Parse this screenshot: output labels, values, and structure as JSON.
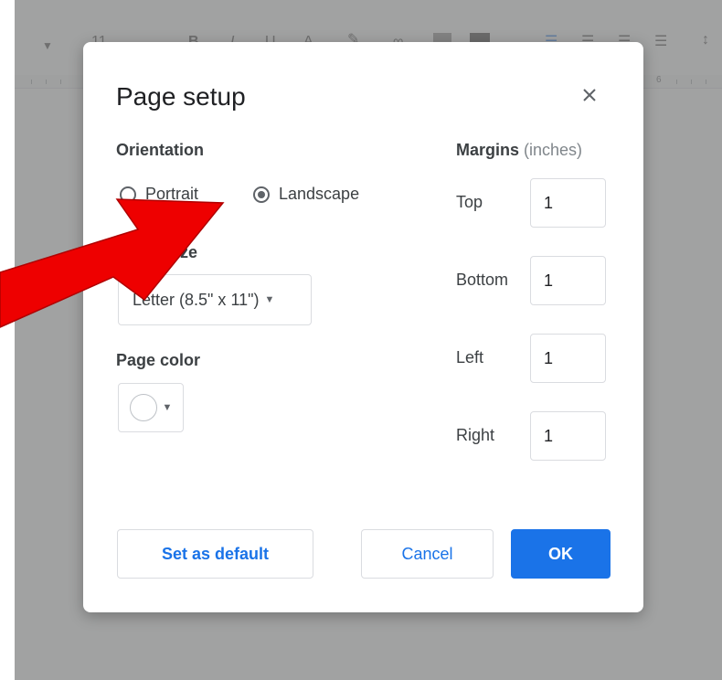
{
  "background": {
    "toolbar": {
      "font_size": "11",
      "bold": "B",
      "italic": "I",
      "underline": "U",
      "text_color": "A"
    },
    "ruler_number": "6"
  },
  "dialog": {
    "title": "Page setup",
    "orientation": {
      "label": "Orientation",
      "options": [
        "Portrait",
        "Landscape"
      ],
      "selected": "Landscape"
    },
    "paper_size": {
      "label": "Paper size",
      "value": "Letter (8.5\" x 11\")"
    },
    "page_color": {
      "label": "Page color",
      "value": "#ffffff"
    },
    "margins": {
      "label": "Margins",
      "unit": "(inches)",
      "top_label": "Top",
      "top": "1",
      "bottom_label": "Bottom",
      "bottom": "1",
      "left_label": "Left",
      "left": "1",
      "right_label": "Right",
      "right": "1"
    },
    "buttons": {
      "set_default": "Set as default",
      "cancel": "Cancel",
      "ok": "OK"
    }
  },
  "annotation": {
    "arrow_color": "#ee0000",
    "target": "Landscape"
  },
  "colors": {
    "accent": "#1a73e8",
    "text": "#3c4043"
  }
}
